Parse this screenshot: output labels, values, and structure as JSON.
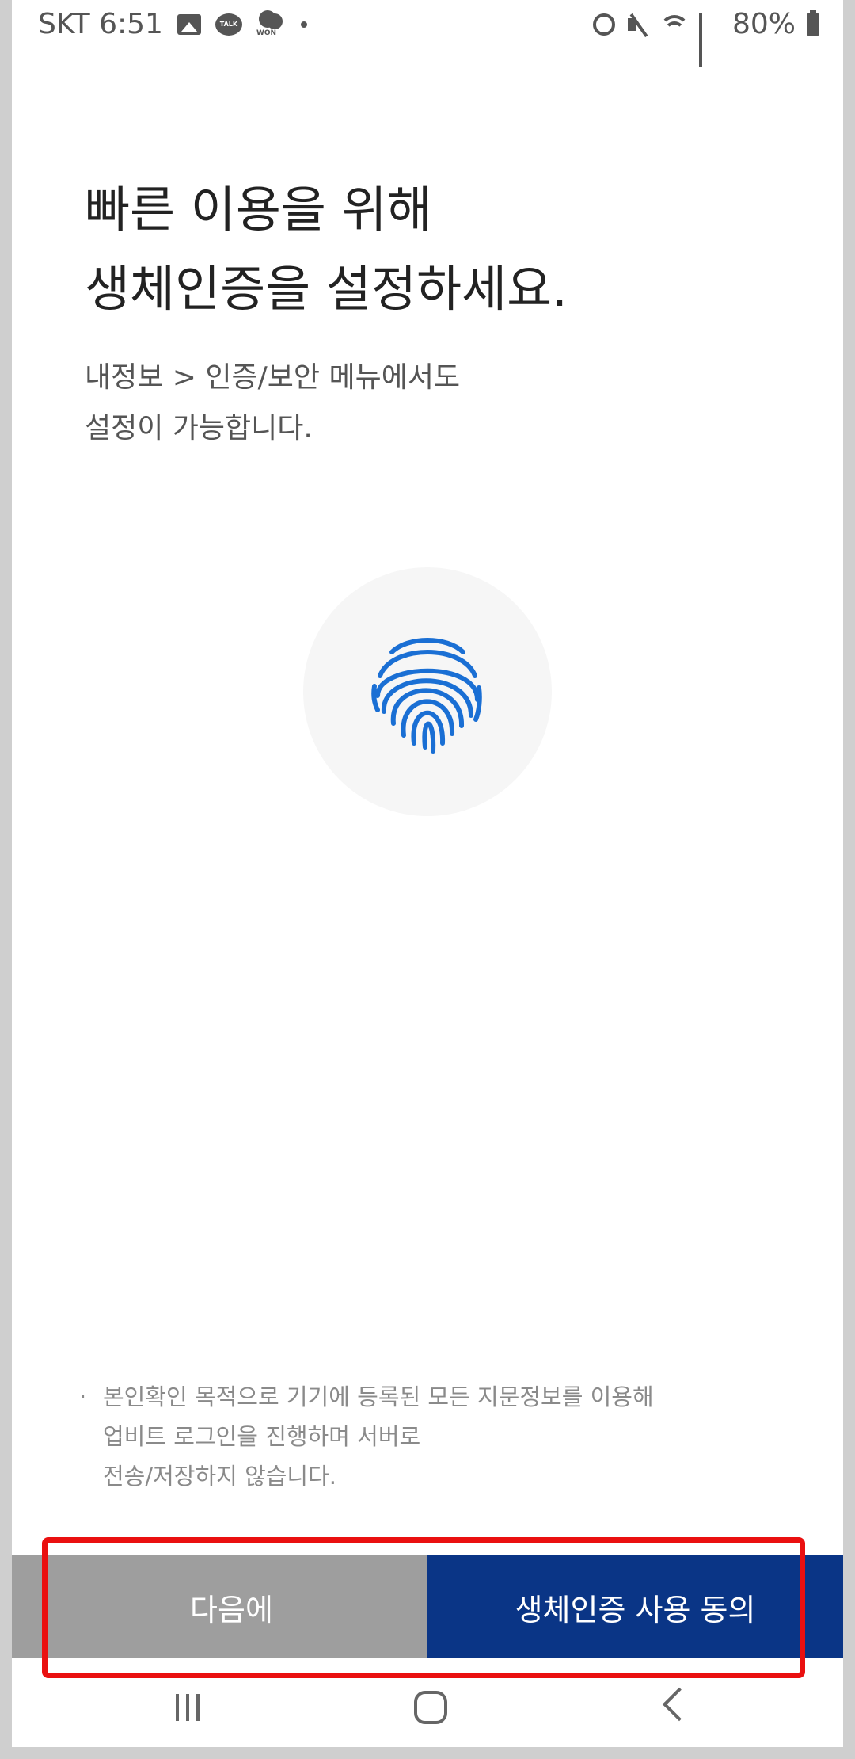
{
  "status_bar": {
    "carrier_time": "SKT 6:51",
    "talk_label": "TALK",
    "won_label": "WON",
    "battery": "80%"
  },
  "headline": {
    "line1": "빠른 이용을 위해",
    "line2": "생체인증을 설정하세요."
  },
  "subtext": {
    "line1": "내정보 > 인증/보안 메뉴에서도",
    "line2": "설정이 가능합니다."
  },
  "fingerprint": {
    "icon": "fingerprint-icon",
    "color": "#1a6fd4"
  },
  "notice": {
    "bullet": "·",
    "line1": "본인확인 목적으로 기기에 등록된 모든 지문정보를 이용해",
    "line2": "업비트 로그인을 진행하며 서버로",
    "line3": "전송/저장하지 않습니다."
  },
  "buttons": {
    "later_label": "다음에",
    "agree_label": "생체인증 사용 동의",
    "later_color": "#9e9e9e",
    "agree_color": "#0a3586"
  },
  "highlight_color": "#ea1010"
}
